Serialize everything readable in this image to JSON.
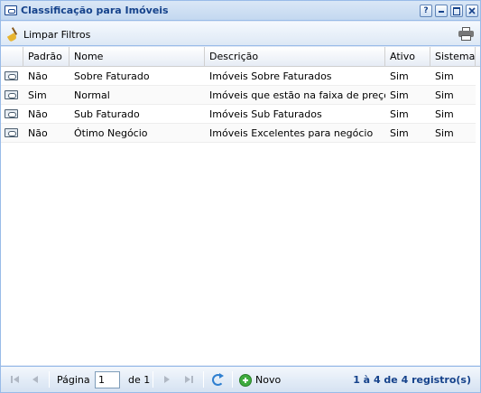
{
  "window": {
    "title": "Classificação para Imóveis",
    "tools": {
      "help": "?"
    }
  },
  "toolbar": {
    "clear_filters_label": "Limpar Filtros"
  },
  "grid": {
    "columns": [
      "Padrão",
      "Nome",
      "Descrição",
      "Ativo",
      "Sistema"
    ],
    "rows": [
      {
        "padrao": "Não",
        "nome": "Sobre Faturado",
        "descricao": "Imóveis Sobre Faturados",
        "ativo": "Sim",
        "sistema": "Sim"
      },
      {
        "padrao": "Sim",
        "nome": "Normal",
        "descricao": "Imóveis que estão na faixa de preços",
        "ativo": "Sim",
        "sistema": "Sim"
      },
      {
        "padrao": "Não",
        "nome": "Sub Faturado",
        "descricao": "Imóveis Sub Faturados",
        "ativo": "Sim",
        "sistema": "Sim"
      },
      {
        "padrao": "Não",
        "nome": "Ótimo Negócio",
        "descricao": "Imóveis Excelentes para negócio",
        "ativo": "Sim",
        "sistema": "Sim"
      }
    ]
  },
  "pager": {
    "page_label": "Página",
    "page_value": "1",
    "of_label": "de 1",
    "new_label": "Novo",
    "info": "1 à 4 de 4 registro(s)"
  },
  "colors": {
    "title_text": "#15428b",
    "panel_border": "#99bbe8",
    "add_icon": "#3eab3e",
    "refresh_icon": "#2f7fd0"
  }
}
